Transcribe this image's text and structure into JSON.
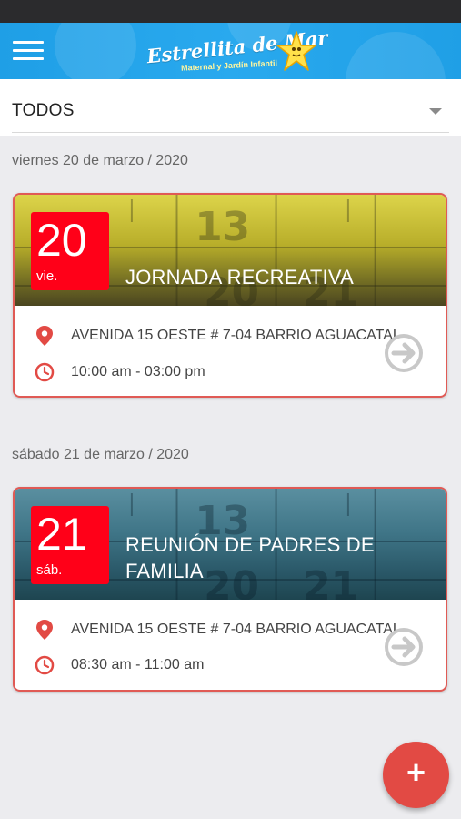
{
  "header": {
    "logo_title": "Estrellita de Mar",
    "logo_subtitle": "Maternal y Jardín Infantil"
  },
  "filter": {
    "selected": "TODOS"
  },
  "events": [
    {
      "date_heading": "viernes 20 de marzo / 2020",
      "day": "20",
      "weekday": "vie.",
      "title": "JORNADA RECREATIVA",
      "location": "AVENIDA 15 OESTE # 7-04 BARRIO AGUACATAL",
      "time": "10:00 am - 03:00 pm",
      "banner_color": "#c9bf38"
    },
    {
      "date_heading": "sábado 21 de marzo / 2020",
      "day": "21",
      "weekday": "sáb.",
      "title": "REUNIÓN DE PADRES DE FAMILIA",
      "location": "AVENIDA 15 OESTE # 7-04 BARRIO AGUACATAL",
      "time": "08:30 am - 11:00 am",
      "banner_color": "#3f7587"
    }
  ],
  "fab": {
    "label": "+"
  },
  "colors": {
    "header": "#29a9ee",
    "accent": "#e24a44",
    "badge": "#ff0018"
  },
  "icons": {
    "menu": "menu-icon",
    "location": "location-pin-icon",
    "time": "clock-icon",
    "detail": "arrow-right-circle-icon",
    "add": "plus-icon",
    "dropdown": "chevron-down-icon"
  }
}
